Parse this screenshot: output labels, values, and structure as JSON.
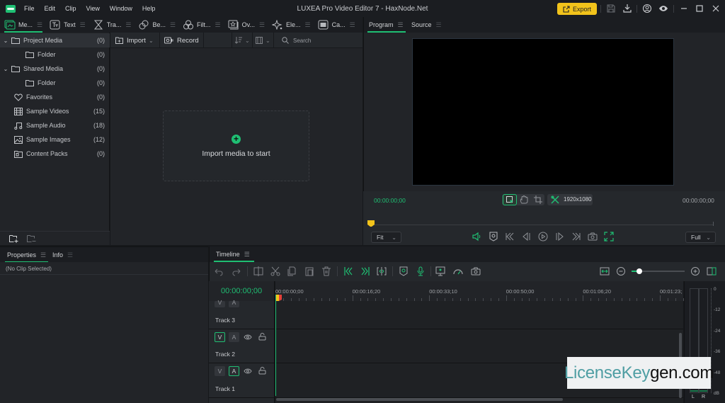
{
  "window": {
    "title": "LUXEA Pro Video Editor 7 - HaxNode.Net",
    "menu": [
      "File",
      "Edit",
      "Clip",
      "View",
      "Window",
      "Help"
    ],
    "export_label": "Export",
    "accent_color": "#1fbf73",
    "export_color": "#f2c31b"
  },
  "media_tabs": [
    {
      "label": "Me...",
      "icon": "media-icon",
      "active": true
    },
    {
      "label": "Text",
      "icon": "text-icon"
    },
    {
      "label": "Tra...",
      "icon": "transition-hourglass-icon"
    },
    {
      "label": "Be...",
      "icon": "beauty-icon"
    },
    {
      "label": "Filt...",
      "icon": "filters-icon"
    },
    {
      "label": "Ov...",
      "icon": "overlay-icon"
    },
    {
      "label": "Ele...",
      "icon": "elements-sparkle-icon"
    },
    {
      "label": "Ca...",
      "icon": "captions-cc-icon"
    }
  ],
  "sidebar": {
    "items": [
      {
        "label": "Project Media",
        "count": "(0)",
        "icon": "folder-icon",
        "expandable": true,
        "selected": true
      },
      {
        "label": "Folder",
        "count": "(0)",
        "icon": "folder-icon",
        "indent": true
      },
      {
        "label": "Shared Media",
        "count": "(0)",
        "icon": "folder-icon",
        "expandable": true
      },
      {
        "label": "Folder",
        "count": "(0)",
        "icon": "folder-icon",
        "indent": true
      },
      {
        "label": "Favorites",
        "count": "(0)",
        "icon": "heart-icon"
      },
      {
        "label": "Sample Videos",
        "count": "(15)",
        "icon": "film-icon"
      },
      {
        "label": "Sample Audio",
        "count": "(18)",
        "icon": "music-note-icon"
      },
      {
        "label": "Sample Images",
        "count": "(12)",
        "icon": "image-icon"
      },
      {
        "label": "Content Packs",
        "count": "(0)",
        "icon": "package-icon"
      }
    ]
  },
  "media_toolbar": {
    "import_label": "Import",
    "record_label": "Record",
    "search_placeholder": "Search"
  },
  "media_area": {
    "import_prompt": "Import media to start"
  },
  "preview": {
    "tabs": [
      {
        "label": "Program",
        "active": true
      },
      {
        "label": "Source"
      }
    ],
    "current_time": "00:00:00;00",
    "total_time": "00:00:00;00",
    "resolution": "1920x1080",
    "fit_select": "Fit",
    "quality_select": "Full"
  },
  "properties": {
    "tabs": [
      {
        "label": "Properties",
        "active": true
      },
      {
        "label": "Info"
      }
    ],
    "empty_text": "(No Clip Selected)"
  },
  "timeline": {
    "tab_label": "Timeline",
    "timecode": "00:00:00;00",
    "ruler_labels": [
      "00:00:00;00",
      "00:00:16;20",
      "00:00:33;10",
      "00:00:50;00",
      "00:01:06;20",
      "00:01:23;"
    ],
    "zoom_level": 0.15,
    "tracks": [
      {
        "name": "Track 3",
        "video_on": false,
        "audio_on": false
      },
      {
        "name": "Track 2",
        "video_on": true,
        "audio_on": false
      },
      {
        "name": "Track 1",
        "video_on": false,
        "audio_on": true
      }
    ],
    "track_btn_v": "V",
    "track_btn_a": "A"
  },
  "audio_meter": {
    "scale": [
      "0",
      "-12",
      "-24",
      "-36",
      "-48",
      "dB"
    ],
    "channels": [
      "L",
      "R"
    ]
  },
  "watermark": {
    "part1": "LicenseKey",
    "part2": "gen.com"
  }
}
